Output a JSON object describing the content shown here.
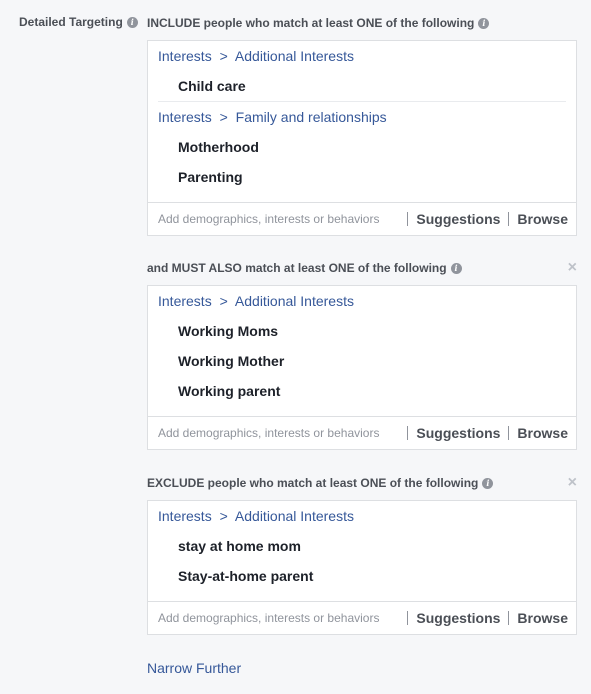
{
  "side_label": "Detailed Targeting",
  "sections": [
    {
      "heading": "INCLUDE people who match at least ONE of the following",
      "groups": [
        {
          "category": "Interests",
          "arrow": ">",
          "subcategory": "Additional Interests",
          "items": [
            "Child care"
          ]
        },
        {
          "category": "Interests",
          "arrow": ">",
          "subcategory": "Family and relationships",
          "items": [
            "Motherhood",
            "Parenting"
          ]
        }
      ],
      "search_placeholder": "Add demographics, interests or behaviors",
      "suggestions_label": "Suggestions",
      "browse_label": "Browse"
    },
    {
      "heading": "and MUST ALSO match at least ONE of the following",
      "close_icon": "×",
      "groups": [
        {
          "category": "Interests",
          "arrow": ">",
          "subcategory": "Additional Interests",
          "items": [
            "Working Moms",
            "Working Mother",
            "Working parent"
          ]
        }
      ],
      "search_placeholder": "Add demographics, interests or behaviors",
      "suggestions_label": "Suggestions",
      "browse_label": "Browse"
    },
    {
      "heading": "EXCLUDE people who match at least ONE of the following",
      "close_icon": "×",
      "groups": [
        {
          "category": "Interests",
          "arrow": ">",
          "subcategory": "Additional Interests",
          "items": [
            "stay at home mom",
            "Stay-at-home parent"
          ]
        }
      ],
      "search_placeholder": "Add demographics, interests or behaviors",
      "suggestions_label": "Suggestions",
      "browse_label": "Browse"
    }
  ],
  "narrow_further": "Narrow Further",
  "info_icon_glyph": "i",
  "colors": {
    "link": "#365899",
    "text": "#1d2129",
    "muted": "#90949c",
    "border": "#dddfe2"
  }
}
